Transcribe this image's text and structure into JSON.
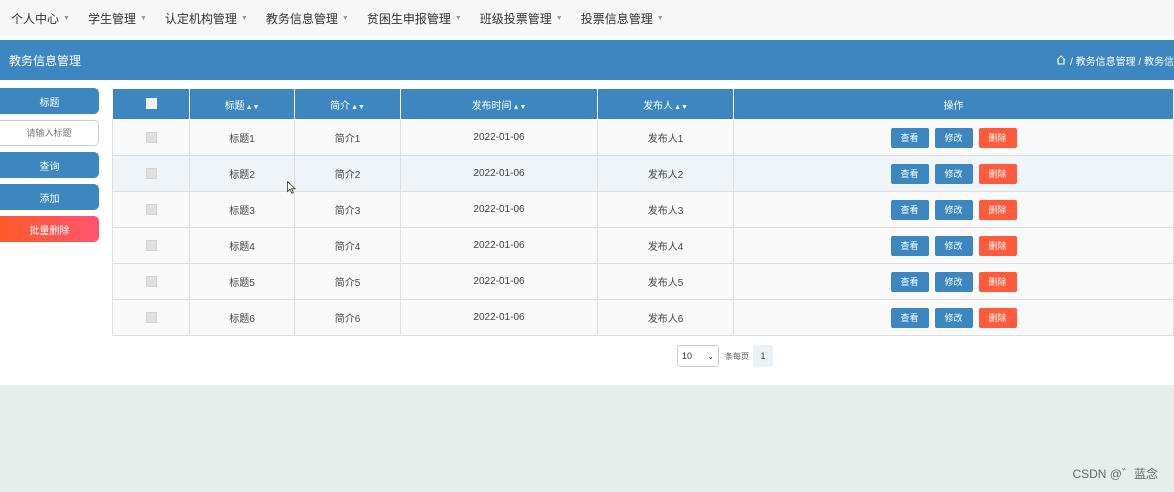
{
  "nav": {
    "items": [
      {
        "label": "个人中心"
      },
      {
        "label": "学生管理"
      },
      {
        "label": "认定机构管理"
      },
      {
        "label": "教务信息管理"
      },
      {
        "label": "贫困生申报管理"
      },
      {
        "label": "班级投票管理"
      },
      {
        "label": "投票信息管理"
      }
    ]
  },
  "header": {
    "page_title": "教务信息管理",
    "breadcrumb": "/ 教务信息管理 / 教务信"
  },
  "sidebar": {
    "field_tag": "标题",
    "search_placeholder": "请输入标题",
    "query_label": "查询",
    "add_label": "添加",
    "batch_delete_label": "批量删除"
  },
  "table": {
    "columns": [
      "标题",
      "简介",
      "发布时间",
      "发布人",
      "操作"
    ],
    "rows": [
      {
        "title": "标题1",
        "intro": "简介1",
        "date": "2022-01-06",
        "publisher": "发布人1"
      },
      {
        "title": "标题2",
        "intro": "简介2",
        "date": "2022-01-06",
        "publisher": "发布人2"
      },
      {
        "title": "标题3",
        "intro": "简介3",
        "date": "2022-01-06",
        "publisher": "发布人3"
      },
      {
        "title": "标题4",
        "intro": "简介4",
        "date": "2022-01-06",
        "publisher": "发布人4"
      },
      {
        "title": "标题5",
        "intro": "简介5",
        "date": "2022-01-06",
        "publisher": "发布人5"
      },
      {
        "title": "标题6",
        "intro": "简介6",
        "date": "2022-01-06",
        "publisher": "发布人6"
      }
    ],
    "actions": {
      "view": "查看",
      "edit": "修改",
      "delete": "删除"
    }
  },
  "pagination": {
    "page_size": "10",
    "per_page_label": "条每页",
    "current_page": "1"
  },
  "watermark": "CSDN @゛蓝念",
  "colors": {
    "primary": "#3c87bf",
    "danger": "#ff5a3c",
    "footer_bg": "#e4efeb"
  }
}
